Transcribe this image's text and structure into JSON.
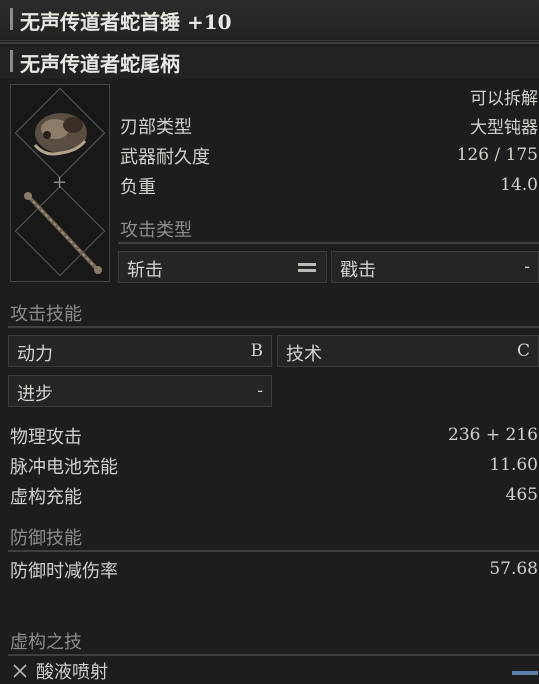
{
  "header": {
    "weapon_title": "无声传道者蛇首锤 +10",
    "handle_title": "无声传道者蛇尾柄"
  },
  "stats_top": {
    "detachable": "可以拆解",
    "blade_type_label": "刃部类型",
    "blade_type_value": "大型钝器",
    "durability_label": "武器耐久度",
    "durability_value": "126 / 175",
    "weight_label": "负重",
    "weight_value": "14.0"
  },
  "attack_type": {
    "section_label": "攻击类型",
    "slash_label": "斩击",
    "slash_icon": "equals-icon",
    "pierce_label": "戳击",
    "pierce_value": "-"
  },
  "attack_skills": {
    "section_label": "攻击技能",
    "rows": [
      {
        "label": "动力",
        "value": "B"
      },
      {
        "label": "技术",
        "value": "C"
      },
      {
        "label": "进步",
        "value": "-"
      }
    ]
  },
  "attack_values": {
    "physical_label": "物理攻击",
    "physical_value": "236 + 216",
    "pulse_label": "脉冲电池充能",
    "pulse_value": "11.60",
    "fable_label": "虚构充能",
    "fable_value": "465"
  },
  "defense": {
    "section_label": "防御技能",
    "guard_label": "防御时减伤率",
    "guard_value": "57.68"
  },
  "fable_arts": {
    "section_label": "虚构之技",
    "art_name": "酸液喷射",
    "art_icon": "crossed-swords-icon"
  },
  "colors": {
    "background": "#1d1d1d",
    "text": "#d8d6d0",
    "muted": "#8e8c88",
    "accent_bar": "#5e7fa8"
  }
}
